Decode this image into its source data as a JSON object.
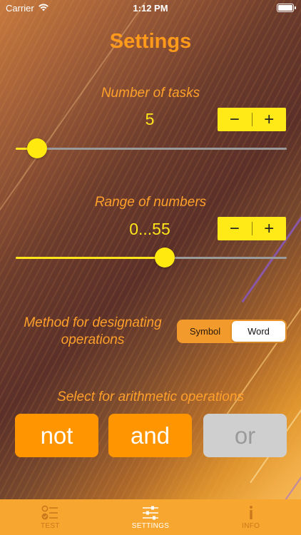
{
  "status_bar": {
    "carrier": "Carrier",
    "time": "1:12 PM"
  },
  "title": "Settings",
  "tasks": {
    "label": "Number of tasks",
    "value": "5",
    "minus": "−",
    "plus": "+",
    "slider_fraction": 0.08
  },
  "range": {
    "label": "Range of numbers",
    "value": "0...55",
    "minus": "−",
    "plus": "+",
    "slider_fraction": 0.55
  },
  "method": {
    "label": "Method for designating operations",
    "options": [
      "Symbol",
      "Word"
    ],
    "selected": "Word"
  },
  "operations": {
    "label": "Select for arithmetic operations",
    "buttons": [
      {
        "label": "not",
        "enabled": true
      },
      {
        "label": "and",
        "enabled": true
      },
      {
        "label": "or",
        "enabled": false
      }
    ]
  },
  "tab_bar": {
    "tabs": [
      {
        "label": "TEST",
        "icon": "checklist-icon",
        "active": false
      },
      {
        "label": "SETTINGS",
        "icon": "sliders-icon",
        "active": true
      },
      {
        "label": "INFO",
        "icon": "info-icon",
        "active": false
      }
    ]
  },
  "colors": {
    "accent_orange": "#ff9500",
    "accent_yellow": "#ffea17",
    "tab_bar": "#f7a62f"
  }
}
